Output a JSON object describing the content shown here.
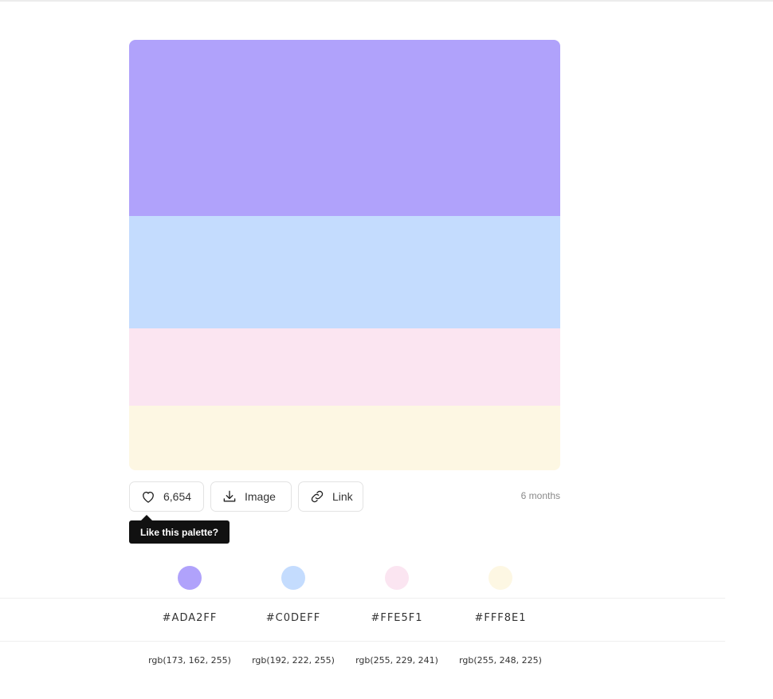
{
  "palette": {
    "colors": [
      {
        "hex": "#ADA2FF",
        "swatch": "#b0a2fb",
        "rgb": "rgb(173, 162, 255)"
      },
      {
        "hex": "#C0DEFF",
        "swatch": "#c4dcfe",
        "rgb": "rgb(192, 222, 255)"
      },
      {
        "hex": "#FFE5F1",
        "swatch": "#fbe5f1",
        "rgb": "rgb(255, 229, 241)"
      },
      {
        "hex": "#FFF8E1",
        "swatch": "#fdf7e3",
        "rgb": "rgb(255, 248, 225)"
      }
    ]
  },
  "actions": {
    "like_count": "6,654",
    "like_icon": "heart-icon",
    "image_label": "Image",
    "image_icon": "download-icon",
    "link_label": "Link",
    "link_icon": "link-icon"
  },
  "tooltip": "Like this palette?",
  "timestamp": "6 months"
}
